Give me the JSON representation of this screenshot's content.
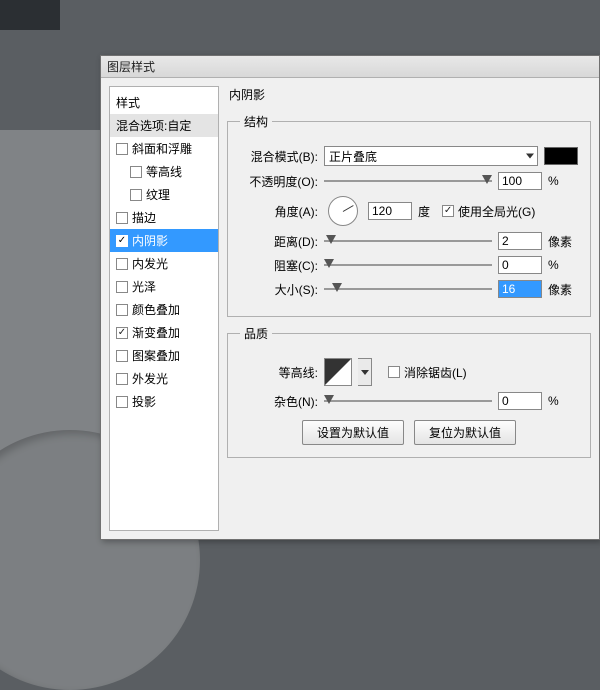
{
  "dialog": {
    "title": "图层样式"
  },
  "styles": {
    "header": "样式",
    "blending_options": "混合选项:自定",
    "items": [
      {
        "label": "斜面和浮雕",
        "checked": false,
        "indent": false
      },
      {
        "label": "等高线",
        "checked": false,
        "indent": true
      },
      {
        "label": "纹理",
        "checked": false,
        "indent": true
      },
      {
        "label": "描边",
        "checked": false,
        "indent": false
      },
      {
        "label": "内阴影",
        "checked": true,
        "indent": false,
        "selected": true
      },
      {
        "label": "内发光",
        "checked": false,
        "indent": false
      },
      {
        "label": "光泽",
        "checked": false,
        "indent": false
      },
      {
        "label": "颜色叠加",
        "checked": false,
        "indent": false
      },
      {
        "label": "渐变叠加",
        "checked": true,
        "indent": false
      },
      {
        "label": "图案叠加",
        "checked": false,
        "indent": false
      },
      {
        "label": "外发光",
        "checked": false,
        "indent": false
      },
      {
        "label": "投影",
        "checked": false,
        "indent": false
      }
    ]
  },
  "panel": {
    "title": "内阴影",
    "structure": {
      "legend": "结构",
      "blend_mode_label": "混合模式(B):",
      "blend_mode_value": "正片叠底",
      "color": "#000000",
      "opacity_label": "不透明度(O):",
      "opacity_value": "100",
      "opacity_unit": "%",
      "angle_label": "角度(A):",
      "angle_value": "120",
      "angle_unit": "度",
      "global_light_checked": true,
      "global_light_label": "使用全局光(G)",
      "distance_label": "距离(D):",
      "distance_value": "2",
      "distance_unit": "像素",
      "choke_label": "阻塞(C):",
      "choke_value": "0",
      "choke_unit": "%",
      "size_label": "大小(S):",
      "size_value": "16",
      "size_unit": "像素"
    },
    "quality": {
      "legend": "品质",
      "contour_label": "等高线:",
      "antialias_checked": false,
      "antialias_label": "消除锯齿(L)",
      "noise_label": "杂色(N):",
      "noise_value": "0",
      "noise_unit": "%"
    },
    "buttons": {
      "make_default": "设置为默认值",
      "reset_default": "复位为默认值"
    }
  }
}
